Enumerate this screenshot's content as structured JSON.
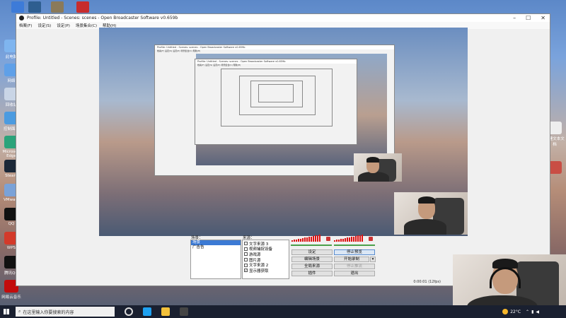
{
  "desktop": {
    "icons_left": [
      {
        "label": "此电脑",
        "color": "#7fb5ef"
      },
      {
        "label": "网络",
        "color": "#5fa0e8"
      },
      {
        "label": "回收站",
        "color": "#c9d5e6"
      },
      {
        "label": "控制面板",
        "color": "#4b9be0"
      },
      {
        "label": "Microsoft Edge",
        "color": "#2ba37a"
      },
      {
        "label": "Steam",
        "color": "#1b2838"
      },
      {
        "label": "VMware",
        "color": "#7aa2d8"
      },
      {
        "label": "QQ",
        "color": "#111111"
      },
      {
        "label": "WPS",
        "color": "#d33a2a"
      },
      {
        "label": "腾讯QQ",
        "color": "#111111"
      },
      {
        "label": "网易云音乐",
        "color": "#c20c0c"
      }
    ],
    "icons_right": [
      {
        "label": "新建文本文档",
        "color": "#eeeeee"
      },
      {
        "label": "",
        "color": "#c94e44"
      }
    ],
    "top_icons": [
      {
        "color": "#3d7bd8"
      },
      {
        "color": "#2e5e90"
      },
      {
        "color": "#8a7a5a"
      },
      {
        "color": "#c72c2c"
      }
    ]
  },
  "obs": {
    "window_title": "Profile: Untitled - Scenes: scenes - Open Broadcaster Software v0.659b",
    "window_controls": [
      "–",
      "☐",
      "✕"
    ],
    "menu": [
      "档案(F)",
      "设定(S)",
      "设定(P)",
      "场景集合(C)",
      "帮助(H)"
    ],
    "nested_title": "Profile: Untitled - Scenes: scenes - Open Broadcaster Software v0.659b",
    "nested_menu": "档案(F)  设定(S)  设定(P)  场景集合(C)  帮助(H)",
    "scenes_label": "场景：",
    "scenes": [
      "场景",
      "广告告"
    ],
    "sources_label": "来源：",
    "sources": [
      {
        "label": "文字来源 3",
        "checked": false
      },
      {
        "label": "视频捕捉设备",
        "checked": false
      },
      {
        "label": "游戏源",
        "checked": false
      },
      {
        "label": "图片源",
        "checked": false
      },
      {
        "label": "文字来源 2",
        "checked": false
      },
      {
        "label": "显示器获取",
        "checked": true
      }
    ],
    "buttons": {
      "settings": "设定",
      "stop_preview": "停止预览",
      "edit_scene": "编辑场景",
      "start_recording": "开始录制",
      "global_sources": "全局来源",
      "plugins": "插件",
      "exit": "退出",
      "stop_stream": "停止推流"
    },
    "status_bar": "0:00:01  (12fps)"
  },
  "taskbar": {
    "search_placeholder": "在这里输入你要搜索的内容",
    "weather": "22°C",
    "apps": [
      {
        "name": "task-view",
        "color": "#dddddd"
      },
      {
        "name": "edge",
        "color": "#1ea1f1"
      },
      {
        "name": "file-explorer",
        "color": "#f3c13a"
      },
      {
        "name": "obs",
        "color": "#444444"
      }
    ]
  }
}
